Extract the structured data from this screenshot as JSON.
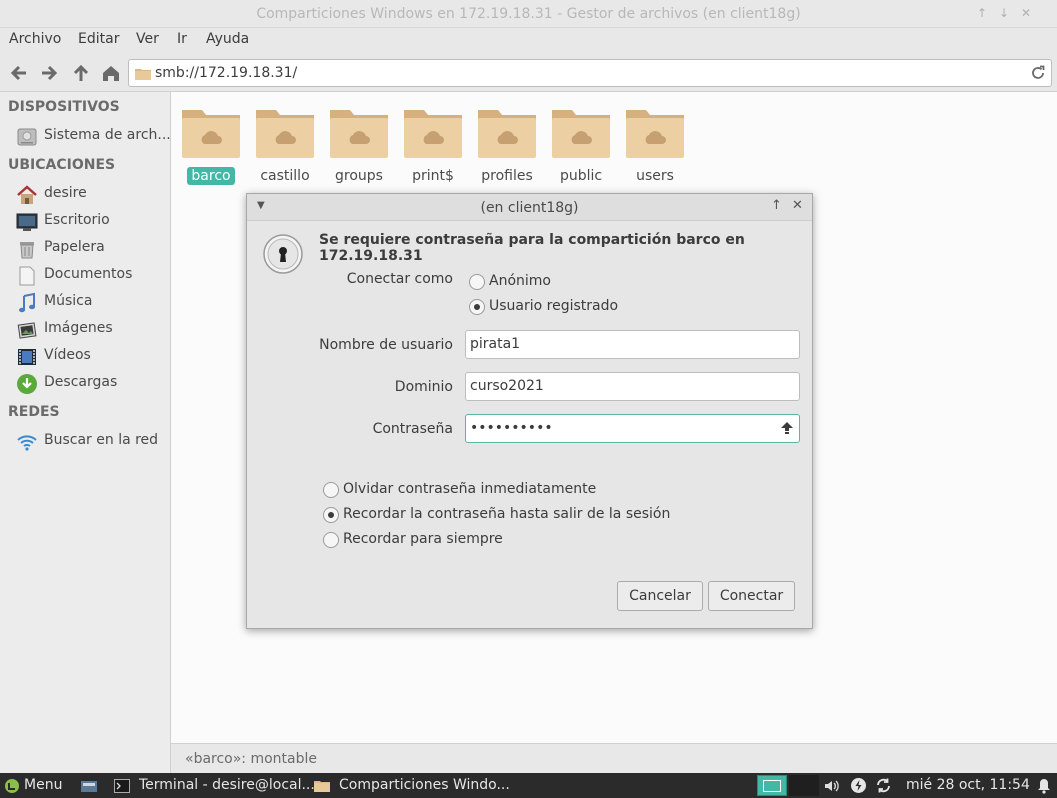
{
  "window": {
    "title": "Comparticiones Windows en 172.19.18.31 - Gestor de archivos (en client18g)",
    "controls": [
      "↑",
      "↓",
      "✕"
    ]
  },
  "menubar": [
    "Archivo",
    "Editar",
    "Ver",
    "Ir",
    "Ayuda"
  ],
  "location": {
    "path": "smb://172.19.18.31/"
  },
  "sidebar": {
    "devices_header": "DISPOSITIVOS",
    "devices": [
      {
        "label": "Sistema de arch...",
        "icon": "hard-disk-icon"
      }
    ],
    "places_header": "UBICACIONES",
    "places": [
      {
        "label": "desire",
        "icon": "home-icon"
      },
      {
        "label": "Escritorio",
        "icon": "desktop-icon"
      },
      {
        "label": "Papelera",
        "icon": "trash-icon"
      },
      {
        "label": "Documentos",
        "icon": "document-icon"
      },
      {
        "label": "Música",
        "icon": "music-icon"
      },
      {
        "label": "Imágenes",
        "icon": "pictures-icon"
      },
      {
        "label": "Vídeos",
        "icon": "video-icon"
      },
      {
        "label": "Descargas",
        "icon": "download-icon"
      }
    ],
    "network_header": "REDES",
    "network": [
      {
        "label": "Buscar en la red",
        "icon": "wifi-icon"
      }
    ]
  },
  "shares": [
    "barco",
    "castillo",
    "groups",
    "print$",
    "profiles",
    "public",
    "users"
  ],
  "selected_share": "barco",
  "statusbar": "«barco»: montable",
  "dialog": {
    "title": "(en client18g)",
    "message": "Se requiere contraseña para la compartición barco en 172.19.18.31",
    "connect_as_label": "Conectar como",
    "connect_as_options": [
      "Anónimo",
      "Usuario registrado"
    ],
    "connect_as_selected": "Usuario registrado",
    "username_label": "Nombre de usuario",
    "username_value": "pirata1",
    "domain_label": "Dominio",
    "domain_value": "curso2021",
    "password_label": "Contraseña",
    "password_value": "••••••••••",
    "remember_options": [
      "Olvidar contraseña inmediatamente",
      "Recordar la contraseña hasta salir de la sesión",
      "Recordar para siempre"
    ],
    "remember_selected": "Recordar la contraseña hasta salir de la sesión",
    "cancel_label": "Cancelar",
    "connect_label": "Conectar"
  },
  "taskbar": {
    "menu_label": "Menu",
    "terminal_label": "Terminal - desire@local...",
    "window_label": "Comparticiones Windo...",
    "clock": "mié 28 oct, 11:54"
  },
  "colors": {
    "accent": "#44b8a6",
    "folder": "#e8c99a",
    "taskbar": "#2b2b2b"
  }
}
